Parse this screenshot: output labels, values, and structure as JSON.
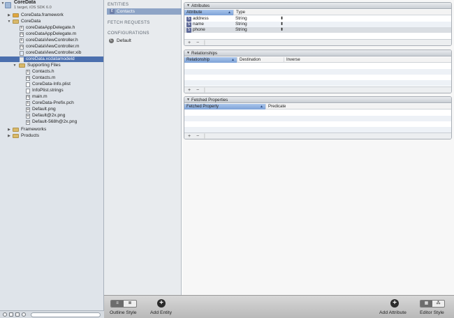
{
  "navigator": {
    "project": {
      "name": "CoreData",
      "subtitle": "1 target, iOS SDK 6.0"
    },
    "items": [
      {
        "label": "CoreData.framework",
        "icon": "framework-icon"
      },
      {
        "label": "CoreData",
        "icon": "folder-icon"
      },
      {
        "label": "coreDataAppDelegate.h",
        "icon": "h"
      },
      {
        "label": "coreDataAppDelegate.m",
        "icon": "m"
      },
      {
        "label": "coreDataViewController.h",
        "icon": "h"
      },
      {
        "label": "coreDataViewController.m",
        "icon": "m"
      },
      {
        "label": "coreDataViewController.xib",
        "icon": "xib"
      },
      {
        "label": "coreData.xcdatamodeld",
        "icon": "datamodel"
      },
      {
        "label": "Supporting Files",
        "icon": "folder-icon"
      },
      {
        "label": "Contacts.h",
        "icon": "h"
      },
      {
        "label": "Contacts.m",
        "icon": "m"
      },
      {
        "label": "CoreData-Info.plist",
        "icon": "plist"
      },
      {
        "label": "InfoPlist.strings",
        "icon": "strings"
      },
      {
        "label": "main.m",
        "icon": "m"
      },
      {
        "label": "CoreData-Prefix.pch",
        "icon": "h"
      },
      {
        "label": "Default.png",
        "icon": "png"
      },
      {
        "label": "Default@2x.png",
        "icon": "png"
      },
      {
        "label": "Default-568h@2x.png",
        "icon": "png"
      },
      {
        "label": "Frameworks",
        "icon": "folder-icon"
      },
      {
        "label": "Products",
        "icon": "folder-icon"
      }
    ]
  },
  "outline": {
    "entities_title": "ENTITIES",
    "entities": [
      {
        "label": "Contacts",
        "badge": "E"
      }
    ],
    "fetch_title": "FETCH REQUESTS",
    "configurations_title": "CONFIGURATIONS",
    "configurations": [
      {
        "label": "Default",
        "badge": "C"
      }
    ]
  },
  "attributes": {
    "title": "Attributes",
    "columns": [
      "Attribute",
      "Type"
    ],
    "rows": [
      {
        "name": "address",
        "type": "String"
      },
      {
        "name": "name",
        "type": "String"
      },
      {
        "name": "phone",
        "type": "String"
      }
    ],
    "badge": "S",
    "add": "+",
    "remove": "−"
  },
  "relationships": {
    "title": "Relationships",
    "columns": [
      "Relationship",
      "Destination",
      "Inverse"
    ],
    "add": "+",
    "remove": "−"
  },
  "fetched": {
    "title": "Fetched Properties",
    "columns": [
      "Fetched Property",
      "Predicate"
    ],
    "add": "+",
    "remove": "−"
  },
  "toolbar": {
    "outline_style": "Outline Style",
    "add_entity": "Add Entity",
    "add_attribute": "Add Attribute",
    "editor_style": "Editor Style"
  }
}
